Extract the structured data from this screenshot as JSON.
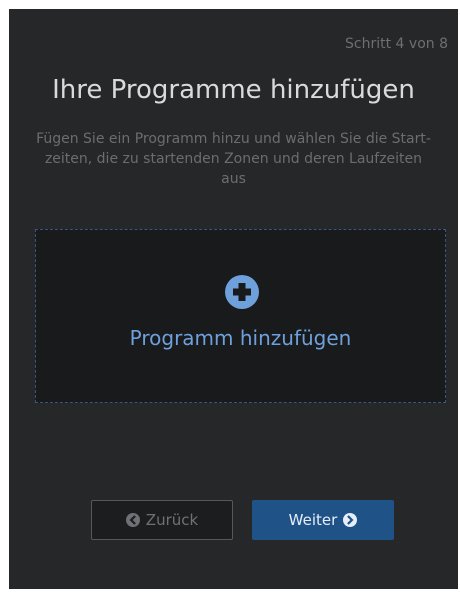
{
  "wizard": {
    "step_text": "Schritt 4 von 8",
    "title": "Ihre Programme hinzufügen",
    "description": "Fügen Sie ein Programm hinzu und wählen Sie die Start- zeiten, die zu startenden Zonen und deren Laufzeiten aus"
  },
  "add_program": {
    "label": "Programm hinzufügen",
    "icon": "plus-circle-icon"
  },
  "navigation": {
    "back_label": "Zurück",
    "back_icon": "chevron-left-circle-icon",
    "next_label": "Weiter",
    "next_icon": "chevron-right-circle-icon"
  },
  "colors": {
    "panel_bg": "#262728",
    "accent": "#6ea0dc",
    "primary_button": "#1f5287"
  }
}
